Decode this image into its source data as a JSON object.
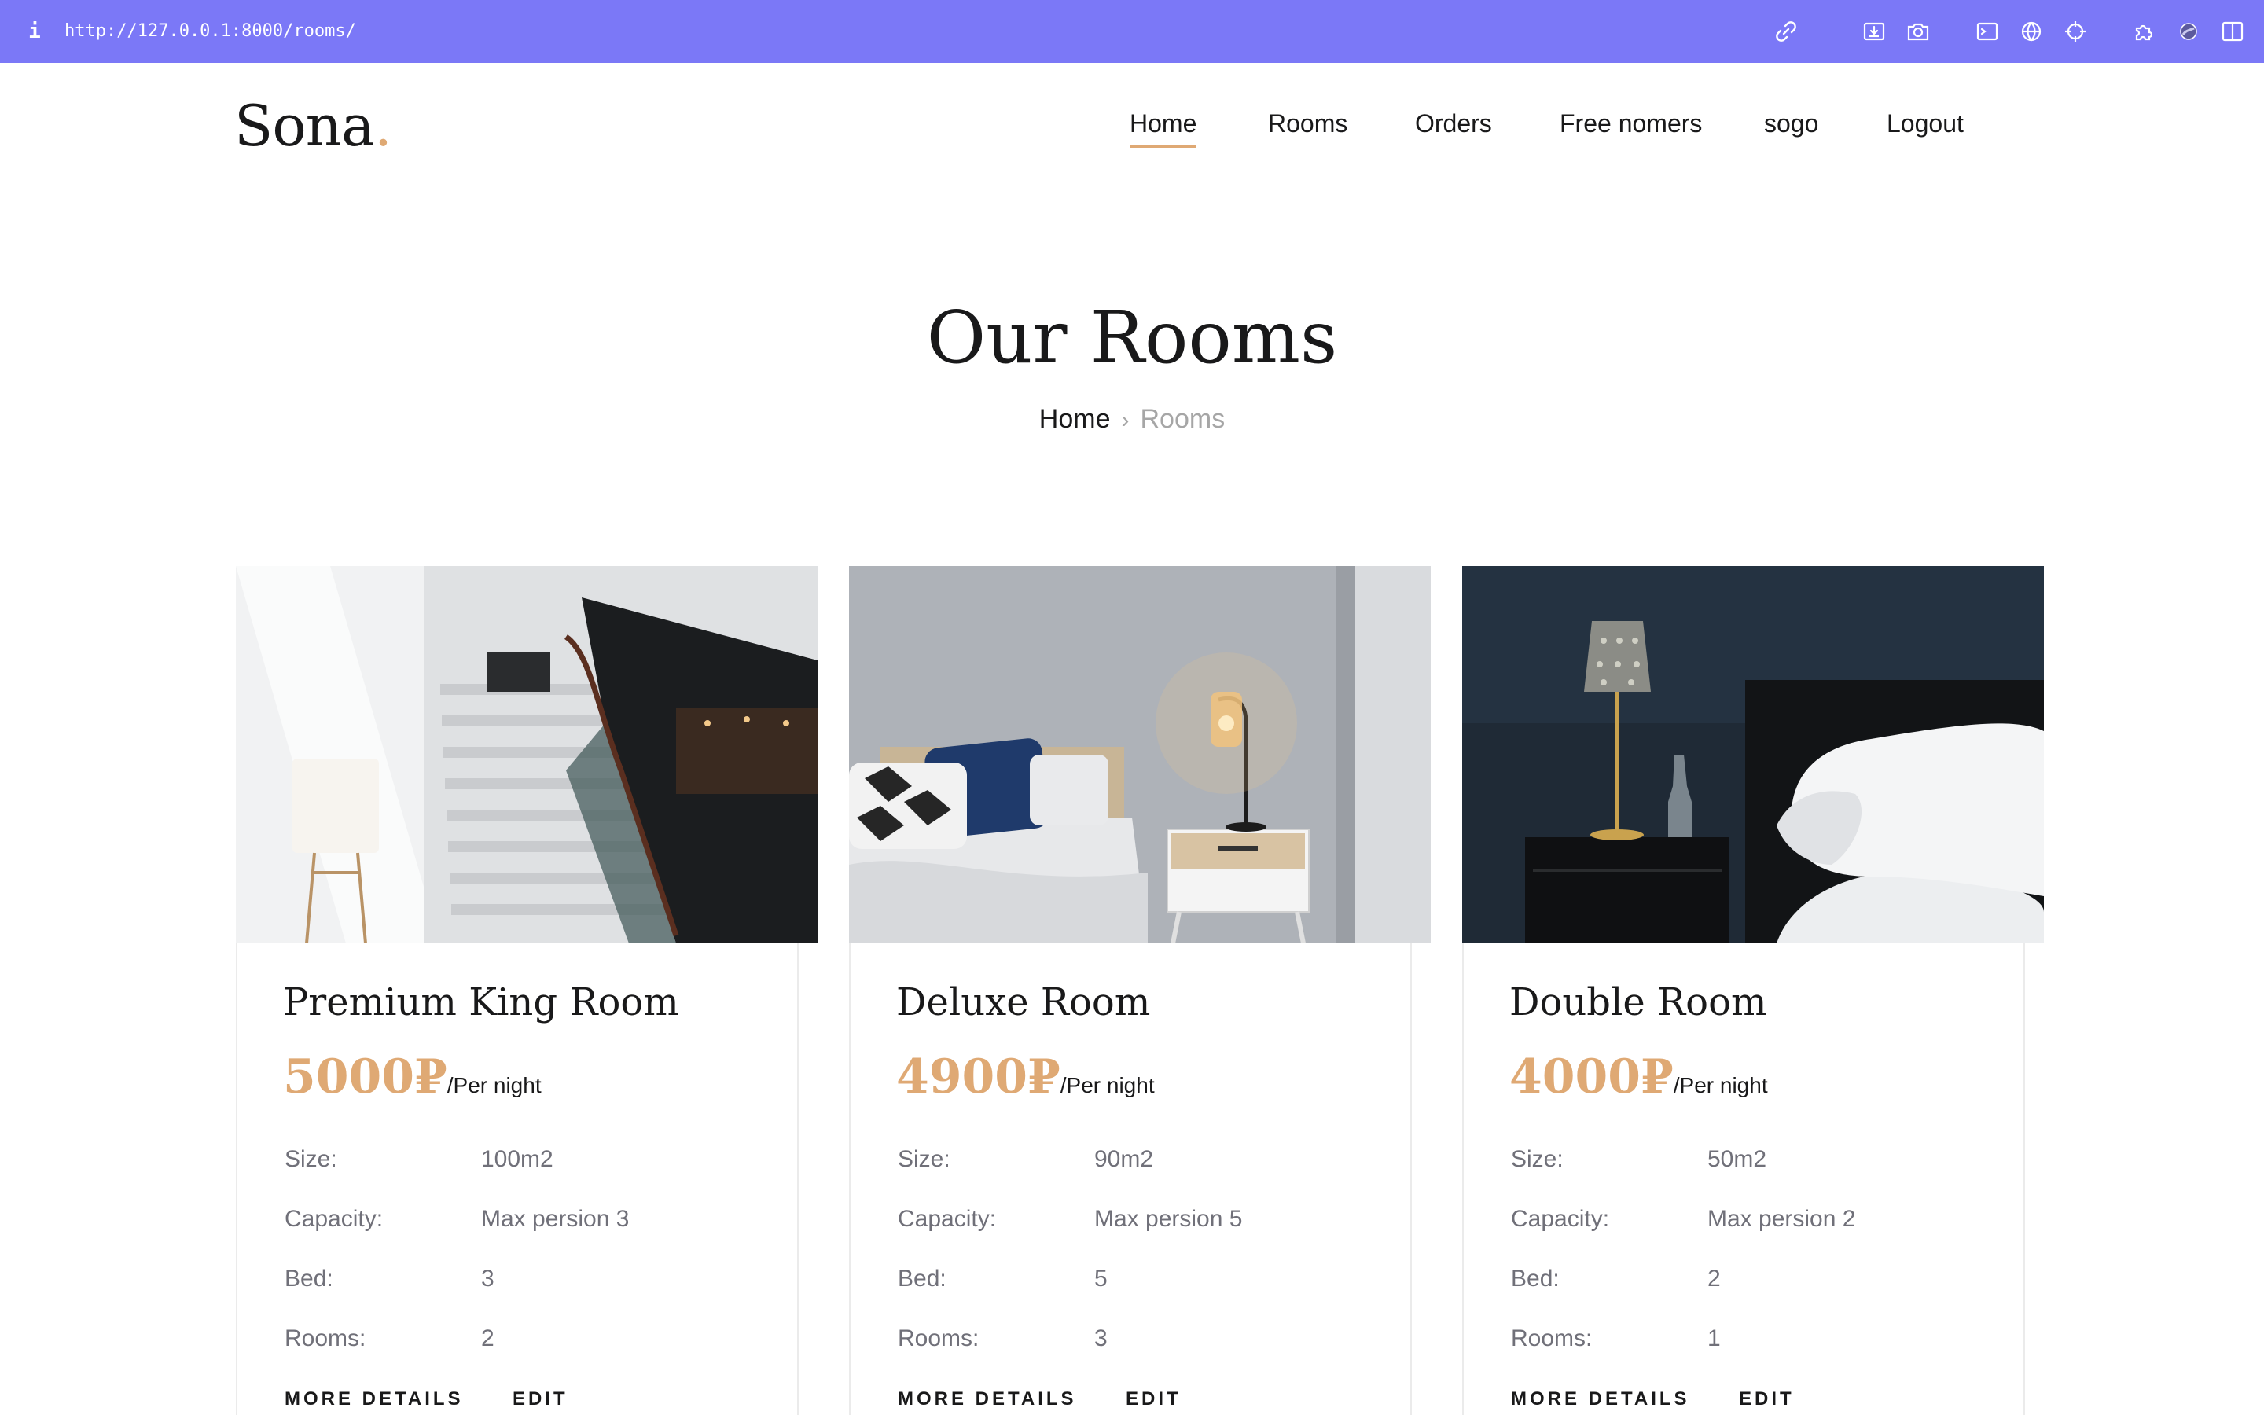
{
  "browser": {
    "info_glyph": "i",
    "url": "http://127.0.0.1:8000/rooms/",
    "toolbar_icons": [
      "link-icon",
      "download-icon",
      "camera-icon",
      "terminal-icon",
      "globe-icon",
      "crosshair-icon",
      "extensions-icon",
      "profile-icon",
      "sidebar-icon"
    ]
  },
  "header": {
    "logo_text": "Sona",
    "logo_dot": ".",
    "nav": [
      {
        "label": "Home",
        "active": true
      },
      {
        "label": "Rooms",
        "active": false
      },
      {
        "label": "Orders",
        "active": false
      },
      {
        "label": "Free nomers",
        "active": false
      },
      {
        "label": "sogo",
        "active": false
      },
      {
        "label": "Logout",
        "active": false
      }
    ]
  },
  "hero": {
    "title": "Our Rooms",
    "breadcrumb": {
      "home": "Home",
      "separator": "›",
      "current": "Rooms"
    }
  },
  "labels": {
    "size": "Size:",
    "capacity": "Capacity:",
    "bed": "Bed:",
    "rooms": "Rooms:",
    "per_night": "/Per night",
    "more_details": "MORE DETAILS",
    "edit": "EDIT"
  },
  "rooms": [
    {
      "title": "Premium King Room",
      "price": "5000₽",
      "size": "100m2",
      "capacity": "Max persion 3",
      "bed": "3",
      "rooms": "2",
      "image": "staircase-photo"
    },
    {
      "title": "Deluxe Room",
      "price": "4900₽",
      "size": "90m2",
      "capacity": "Max persion 5",
      "bed": "5",
      "rooms": "3",
      "image": "bedroom-lamp-photo"
    },
    {
      "title": "Double Room",
      "price": "4000₽",
      "size": "50m2",
      "capacity": "Max persion 2",
      "bed": "2",
      "rooms": "1",
      "image": "dark-bedroom-photo"
    }
  ],
  "colors": {
    "chrome_bar": "#7b78f7",
    "accent": "#dfa974",
    "text_dark": "#19191a",
    "text_muted": "#707079"
  }
}
